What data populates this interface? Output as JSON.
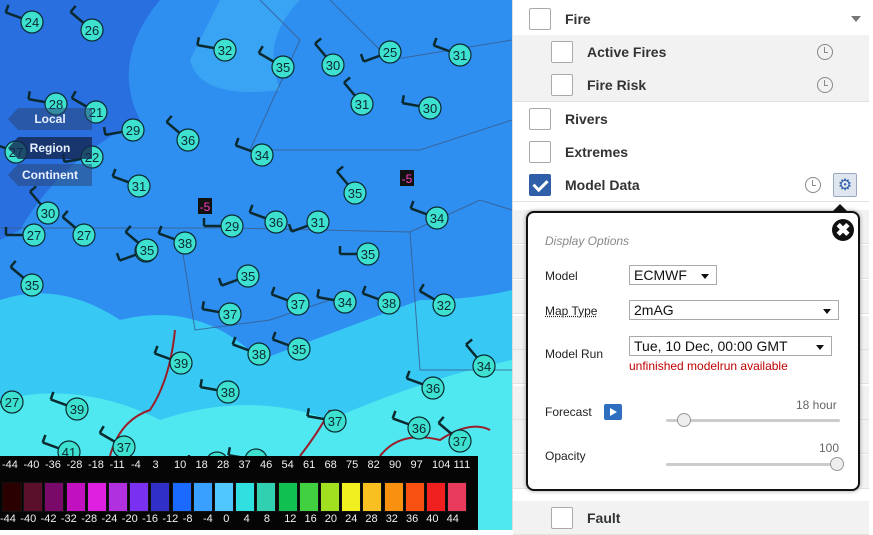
{
  "zoom": {
    "local": "Local",
    "region": "Region",
    "continent": "Continent"
  },
  "map_labels": {
    "neg_a": "-5",
    "neg_b": "-5"
  },
  "stations": [
    "24",
    "26",
    "32",
    "35",
    "30",
    "25",
    "31",
    "27",
    "28",
    "21",
    "29",
    "36",
    "31",
    "30",
    "27",
    "22",
    "34",
    "35",
    "31",
    "30",
    "27",
    "38",
    "29",
    "36",
    "31",
    "34",
    "35",
    "35",
    "35",
    "34",
    "38",
    "32",
    "37",
    "37",
    "38",
    "35",
    "35",
    "39",
    "38",
    "34",
    "27",
    "39",
    "37",
    "41",
    "37",
    "37",
    "38",
    "36",
    "37",
    "38",
    "39",
    "42",
    "37",
    "36",
    "35",
    "35"
  ],
  "legend": {
    "top_ticks": [
      "-44",
      "-40",
      "-36",
      "-28",
      "-18",
      "-11",
      "-4",
      "3",
      "10",
      "18",
      "28",
      "37",
      "46",
      "54",
      "61",
      "68",
      "75",
      "82",
      "90",
      "97",
      "104",
      "111"
    ],
    "bottom_ticks": [
      "-44",
      "-40",
      "-42",
      "-32",
      "-28",
      "-24",
      "-20",
      "-16",
      "-12",
      "-8",
      "-4",
      "0",
      "4",
      "8",
      "12",
      "16",
      "20",
      "24",
      "28",
      "32",
      "36",
      "40",
      "44"
    ],
    "colors": [
      "#2a0000",
      "#5a0f2a",
      "#7a0a6a",
      "#c010c0",
      "#e020e0",
      "#b030e0",
      "#7a30f0",
      "#3030c8",
      "#1a6aff",
      "#3aa0ff",
      "#50c8ff",
      "#30e0e0",
      "#30d0b0",
      "#10c050",
      "#40d040",
      "#a0e020",
      "#f0f020",
      "#f8c020",
      "#f89010",
      "#f85010",
      "#f02020",
      "#e83a5a"
    ]
  },
  "layers": [
    {
      "label": "Fire",
      "checked": false,
      "sub": false
    },
    {
      "label": "Active Fires",
      "checked": false,
      "sub": true
    },
    {
      "label": "Fire Risk",
      "checked": false,
      "sub": true
    },
    {
      "label": "Rivers",
      "checked": false,
      "sub": false
    },
    {
      "label": "Extremes",
      "checked": false,
      "sub": false
    },
    {
      "label": "Model Data",
      "checked": true,
      "sub": false
    },
    {
      "label": "Fault",
      "checked": false,
      "sub": true
    }
  ],
  "popup": {
    "title": "Display Options",
    "close": "✖",
    "model_label": "Model",
    "model_value": "ECMWF",
    "maptype_label": "Map Type",
    "maptype_value": "2mAG",
    "modelrun_label": "Model Run",
    "modelrun_value": "Tue, 10 Dec, 00:00 GMT",
    "modelrun_warning": "unfinished modelrun available",
    "forecast_label": "Forecast",
    "forecast_value": "18 hour",
    "forecast_level": 0.1,
    "opacity_label": "Opacity",
    "opacity_value": "100",
    "opacity_level": 1.0
  }
}
